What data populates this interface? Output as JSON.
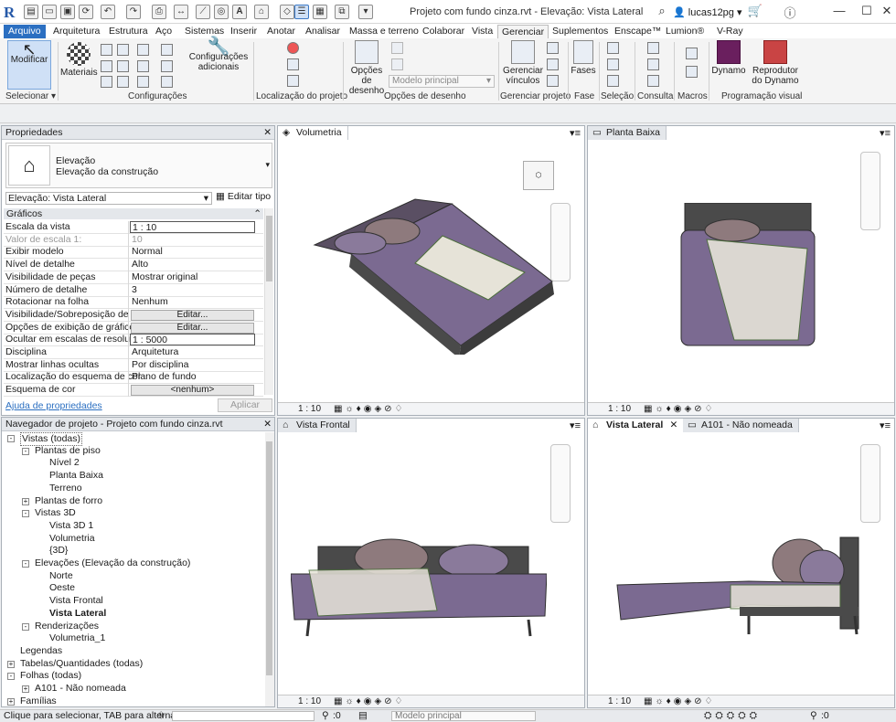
{
  "window": {
    "title": "Projeto com fundo cinza.rvt - Elevação: Vista Lateral",
    "user": "lucas12pg",
    "logo": "R",
    "colors": {
      "accent": "#2b6fc1",
      "bed_fabric": "#7b6a91",
      "bed_pillow": "#8e7a7d",
      "bed_sheet": "#e6e3d8",
      "frame": "#4a4a4a"
    }
  },
  "ribbon": {
    "tabs": [
      "Arquivo",
      "Arquitetura",
      "Estrutura",
      "Aço",
      "Sistemas",
      "Inserir",
      "Anotar",
      "Analisar",
      "Massa e terreno",
      "Colaborar",
      "Vista",
      "Gerenciar",
      "Suplementos",
      "Enscape™",
      "Lumion®",
      "V-Ray"
    ],
    "active_tab": "Gerenciar",
    "buttons": {
      "modificar": "Modificar",
      "materiais": "Materiais",
      "config_adicionais": "Configurações adicionais",
      "opcoes_desenho": "Opções de desenho",
      "modelo_principal": "Modelo principal",
      "gerenciar_vinculos": "Gerenciar vínculos",
      "fases": "Fases",
      "dynamo": "Dynamo",
      "reprodutor_dynamo": "Reprodutor do Dynamo"
    },
    "groups": {
      "selecionar": "Selecionar",
      "configuracoes": "Configurações",
      "localizacao": "Localização do projeto",
      "opcoes_desenho": "Opções de desenho",
      "gerenciar_projeto": "Gerenciar projeto",
      "fase": "Fase",
      "selecao": "Seleção",
      "consulta": "Consulta",
      "macros": "Macros",
      "programacao": "Programação visual"
    }
  },
  "properties": {
    "title": "Propriedades",
    "type_line1": "Elevação",
    "type_line2": "Elevação da construção",
    "selector": "Elevação: Vista Lateral",
    "edit_type": "Editar tipo",
    "section": "Gráficos",
    "rows": [
      {
        "label": "Escala da vista",
        "value": "1 : 10",
        "kind": "input"
      },
      {
        "label": "Valor de escala    1:",
        "value": "10",
        "kind": "grey"
      },
      {
        "label": "Exibir modelo",
        "value": "Normal",
        "kind": "text"
      },
      {
        "label": "Nível de detalhe",
        "value": "Alto",
        "kind": "text"
      },
      {
        "label": "Visibilidade de peças",
        "value": "Mostrar original",
        "kind": "text"
      },
      {
        "label": "Número de detalhe",
        "value": "3",
        "kind": "text"
      },
      {
        "label": "Rotacionar na folha",
        "value": "Nenhum",
        "kind": "text"
      },
      {
        "label": "Visibilidade/Sobreposição de ...",
        "value": "Editar...",
        "kind": "button"
      },
      {
        "label": "Opções de exibição de gráficos",
        "value": "Editar...",
        "kind": "button"
      },
      {
        "label": "Ocultar em escalas de resoluç...",
        "value": "1 : 5000",
        "kind": "input"
      },
      {
        "label": "Disciplina",
        "value": "Arquitetura",
        "kind": "text"
      },
      {
        "label": "Mostrar linhas ocultas",
        "value": "Por disciplina",
        "kind": "text"
      },
      {
        "label": "Localização do esquema de cor",
        "value": "Plano de fundo",
        "kind": "text"
      },
      {
        "label": "Esquema de cor",
        "value": "<nenhum>",
        "kind": "button"
      }
    ],
    "help": "Ajuda de propriedades",
    "apply": "Aplicar"
  },
  "navigator": {
    "title": "Navegador de projeto - Projeto com fundo cinza.rvt",
    "items": [
      {
        "label": "Vistas (todas)",
        "level": 0,
        "toggle": "-",
        "bold": false
      },
      {
        "label": "Plantas de piso",
        "level": 1,
        "toggle": "-",
        "bold": false
      },
      {
        "label": "Nível 2",
        "level": 2,
        "toggle": "",
        "bold": false
      },
      {
        "label": "Planta Baixa",
        "level": 2,
        "toggle": "",
        "bold": false
      },
      {
        "label": "Terreno",
        "level": 2,
        "toggle": "",
        "bold": false
      },
      {
        "label": "Plantas de forro",
        "level": 1,
        "toggle": "+",
        "bold": false
      },
      {
        "label": "Vistas 3D",
        "level": 1,
        "toggle": "-",
        "bold": false
      },
      {
        "label": "Vista 3D 1",
        "level": 2,
        "toggle": "",
        "bold": false
      },
      {
        "label": "Volumetria",
        "level": 2,
        "toggle": "",
        "bold": false
      },
      {
        "label": "{3D}",
        "level": 2,
        "toggle": "",
        "bold": false
      },
      {
        "label": "Elevações (Elevação da construção)",
        "level": 1,
        "toggle": "-",
        "bold": false
      },
      {
        "label": "Norte",
        "level": 2,
        "toggle": "",
        "bold": false
      },
      {
        "label": "Oeste",
        "level": 2,
        "toggle": "",
        "bold": false
      },
      {
        "label": "Vista Frontal",
        "level": 2,
        "toggle": "",
        "bold": false
      },
      {
        "label": "Vista Lateral",
        "level": 2,
        "toggle": "",
        "bold": true
      },
      {
        "label": "Renderizações",
        "level": 1,
        "toggle": "-",
        "bold": false
      },
      {
        "label": "Volumetria_1",
        "level": 2,
        "toggle": "",
        "bold": false
      },
      {
        "label": "Legendas",
        "level": 0,
        "toggle": "",
        "bold": false
      },
      {
        "label": "Tabelas/Quantidades (todas)",
        "level": 0,
        "toggle": "+",
        "bold": false
      },
      {
        "label": "Folhas (todas)",
        "level": 0,
        "toggle": "-",
        "bold": false
      },
      {
        "label": "A101 - Não nomeada",
        "level": 1,
        "toggle": "+",
        "bold": false
      },
      {
        "label": "Famílias",
        "level": 0,
        "toggle": "+",
        "bold": false
      }
    ]
  },
  "views": {
    "volumetria": {
      "tab": "Volumetria",
      "scale": "1 : 10"
    },
    "planta": {
      "tab": "Planta Baixa",
      "scale": "1 : 10"
    },
    "frontal": {
      "tab": "Vista Frontal",
      "scale": "1 : 10"
    },
    "lateral": {
      "tab": "Vista Lateral",
      "tab2": "A101 - Não nomeada",
      "scale": "1 : 10"
    }
  },
  "status": {
    "hint": "Clique para selecionar, TAB para alternat",
    "workset": ":0",
    "model": "Modelo principal",
    "filter": ":0"
  }
}
